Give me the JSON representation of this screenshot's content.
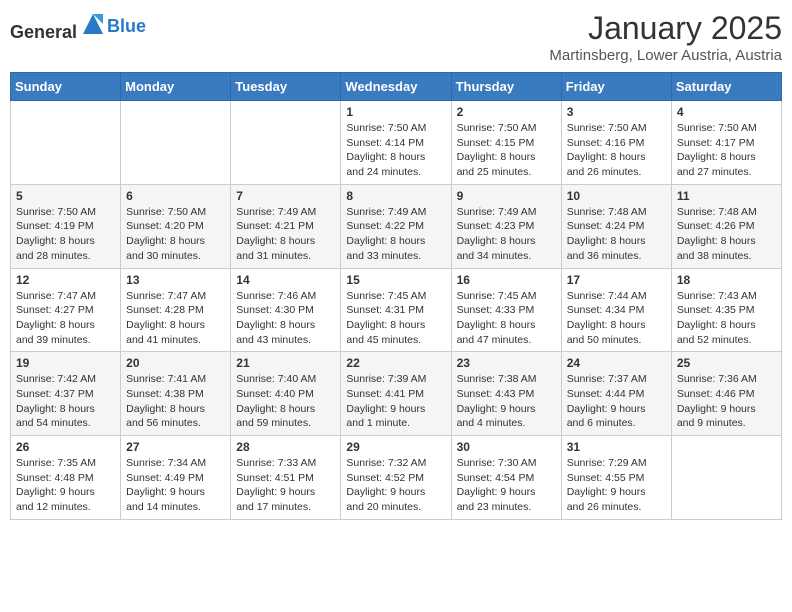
{
  "header": {
    "logo_general": "General",
    "logo_blue": "Blue",
    "month": "January 2025",
    "location": "Martinsberg, Lower Austria, Austria"
  },
  "weekdays": [
    "Sunday",
    "Monday",
    "Tuesday",
    "Wednesday",
    "Thursday",
    "Friday",
    "Saturday"
  ],
  "weeks": [
    [
      {
        "day": "",
        "info": ""
      },
      {
        "day": "",
        "info": ""
      },
      {
        "day": "",
        "info": ""
      },
      {
        "day": "1",
        "sunrise": "Sunrise: 7:50 AM",
        "sunset": "Sunset: 4:14 PM",
        "daylight": "Daylight: 8 hours and 24 minutes."
      },
      {
        "day": "2",
        "sunrise": "Sunrise: 7:50 AM",
        "sunset": "Sunset: 4:15 PM",
        "daylight": "Daylight: 8 hours and 25 minutes."
      },
      {
        "day": "3",
        "sunrise": "Sunrise: 7:50 AM",
        "sunset": "Sunset: 4:16 PM",
        "daylight": "Daylight: 8 hours and 26 minutes."
      },
      {
        "day": "4",
        "sunrise": "Sunrise: 7:50 AM",
        "sunset": "Sunset: 4:17 PM",
        "daylight": "Daylight: 8 hours and 27 minutes."
      }
    ],
    [
      {
        "day": "5",
        "sunrise": "Sunrise: 7:50 AM",
        "sunset": "Sunset: 4:19 PM",
        "daylight": "Daylight: 8 hours and 28 minutes."
      },
      {
        "day": "6",
        "sunrise": "Sunrise: 7:50 AM",
        "sunset": "Sunset: 4:20 PM",
        "daylight": "Daylight: 8 hours and 30 minutes."
      },
      {
        "day": "7",
        "sunrise": "Sunrise: 7:49 AM",
        "sunset": "Sunset: 4:21 PM",
        "daylight": "Daylight: 8 hours and 31 minutes."
      },
      {
        "day": "8",
        "sunrise": "Sunrise: 7:49 AM",
        "sunset": "Sunset: 4:22 PM",
        "daylight": "Daylight: 8 hours and 33 minutes."
      },
      {
        "day": "9",
        "sunrise": "Sunrise: 7:49 AM",
        "sunset": "Sunset: 4:23 PM",
        "daylight": "Daylight: 8 hours and 34 minutes."
      },
      {
        "day": "10",
        "sunrise": "Sunrise: 7:48 AM",
        "sunset": "Sunset: 4:24 PM",
        "daylight": "Daylight: 8 hours and 36 minutes."
      },
      {
        "day": "11",
        "sunrise": "Sunrise: 7:48 AM",
        "sunset": "Sunset: 4:26 PM",
        "daylight": "Daylight: 8 hours and 38 minutes."
      }
    ],
    [
      {
        "day": "12",
        "sunrise": "Sunrise: 7:47 AM",
        "sunset": "Sunset: 4:27 PM",
        "daylight": "Daylight: 8 hours and 39 minutes."
      },
      {
        "day": "13",
        "sunrise": "Sunrise: 7:47 AM",
        "sunset": "Sunset: 4:28 PM",
        "daylight": "Daylight: 8 hours and 41 minutes."
      },
      {
        "day": "14",
        "sunrise": "Sunrise: 7:46 AM",
        "sunset": "Sunset: 4:30 PM",
        "daylight": "Daylight: 8 hours and 43 minutes."
      },
      {
        "day": "15",
        "sunrise": "Sunrise: 7:45 AM",
        "sunset": "Sunset: 4:31 PM",
        "daylight": "Daylight: 8 hours and 45 minutes."
      },
      {
        "day": "16",
        "sunrise": "Sunrise: 7:45 AM",
        "sunset": "Sunset: 4:33 PM",
        "daylight": "Daylight: 8 hours and 47 minutes."
      },
      {
        "day": "17",
        "sunrise": "Sunrise: 7:44 AM",
        "sunset": "Sunset: 4:34 PM",
        "daylight": "Daylight: 8 hours and 50 minutes."
      },
      {
        "day": "18",
        "sunrise": "Sunrise: 7:43 AM",
        "sunset": "Sunset: 4:35 PM",
        "daylight": "Daylight: 8 hours and 52 minutes."
      }
    ],
    [
      {
        "day": "19",
        "sunrise": "Sunrise: 7:42 AM",
        "sunset": "Sunset: 4:37 PM",
        "daylight": "Daylight: 8 hours and 54 minutes."
      },
      {
        "day": "20",
        "sunrise": "Sunrise: 7:41 AM",
        "sunset": "Sunset: 4:38 PM",
        "daylight": "Daylight: 8 hours and 56 minutes."
      },
      {
        "day": "21",
        "sunrise": "Sunrise: 7:40 AM",
        "sunset": "Sunset: 4:40 PM",
        "daylight": "Daylight: 8 hours and 59 minutes."
      },
      {
        "day": "22",
        "sunrise": "Sunrise: 7:39 AM",
        "sunset": "Sunset: 4:41 PM",
        "daylight": "Daylight: 9 hours and 1 minute."
      },
      {
        "day": "23",
        "sunrise": "Sunrise: 7:38 AM",
        "sunset": "Sunset: 4:43 PM",
        "daylight": "Daylight: 9 hours and 4 minutes."
      },
      {
        "day": "24",
        "sunrise": "Sunrise: 7:37 AM",
        "sunset": "Sunset: 4:44 PM",
        "daylight": "Daylight: 9 hours and 6 minutes."
      },
      {
        "day": "25",
        "sunrise": "Sunrise: 7:36 AM",
        "sunset": "Sunset: 4:46 PM",
        "daylight": "Daylight: 9 hours and 9 minutes."
      }
    ],
    [
      {
        "day": "26",
        "sunrise": "Sunrise: 7:35 AM",
        "sunset": "Sunset: 4:48 PM",
        "daylight": "Daylight: 9 hours and 12 minutes."
      },
      {
        "day": "27",
        "sunrise": "Sunrise: 7:34 AM",
        "sunset": "Sunset: 4:49 PM",
        "daylight": "Daylight: 9 hours and 14 minutes."
      },
      {
        "day": "28",
        "sunrise": "Sunrise: 7:33 AM",
        "sunset": "Sunset: 4:51 PM",
        "daylight": "Daylight: 9 hours and 17 minutes."
      },
      {
        "day": "29",
        "sunrise": "Sunrise: 7:32 AM",
        "sunset": "Sunset: 4:52 PM",
        "daylight": "Daylight: 9 hours and 20 minutes."
      },
      {
        "day": "30",
        "sunrise": "Sunrise: 7:30 AM",
        "sunset": "Sunset: 4:54 PM",
        "daylight": "Daylight: 9 hours and 23 minutes."
      },
      {
        "day": "31",
        "sunrise": "Sunrise: 7:29 AM",
        "sunset": "Sunset: 4:55 PM",
        "daylight": "Daylight: 9 hours and 26 minutes."
      },
      {
        "day": "",
        "info": ""
      }
    ]
  ]
}
